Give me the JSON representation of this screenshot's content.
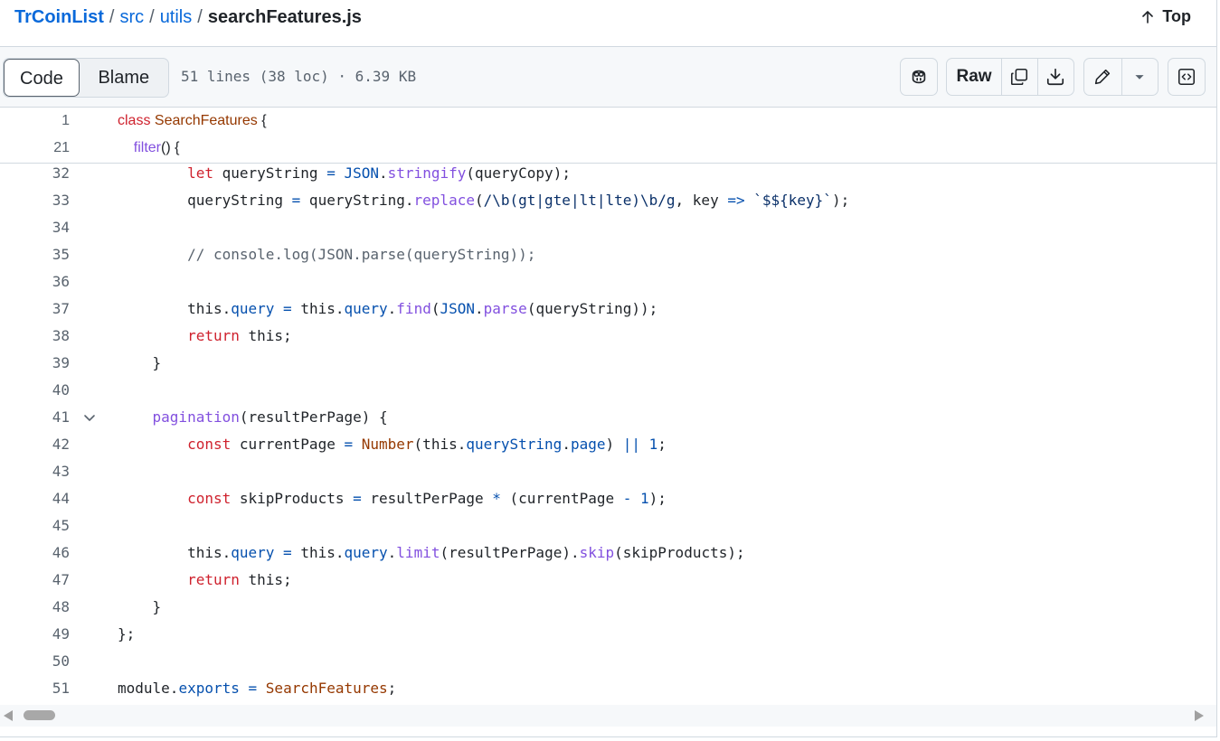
{
  "breadcrumb": {
    "repo": "TrCoinList",
    "dirs": [
      "src",
      "utils"
    ],
    "file": "searchFeatures.js",
    "separator": "/"
  },
  "top_link": "Top",
  "toolbar": {
    "tab_code": "Code",
    "tab_blame": "Blame",
    "file_info": "51 lines (38 loc) · 6.39 KB",
    "raw_label": "Raw"
  },
  "sticky_lines": [
    {
      "n": "1",
      "html": "<span class=\"k\">class</span> <span class=\"ent\">SearchFeatures</span> {"
    },
    {
      "n": "21",
      "html": "    <span class=\"f\">filter</span>() {"
    }
  ],
  "lines": [
    {
      "n": "32",
      "html": "        <span class=\"k\">let</span> queryString <span class=\"c\">=</span> <span class=\"c\">JSON</span>.<span class=\"f\">stringify</span>(queryCopy);"
    },
    {
      "n": "33",
      "html": "        queryString <span class=\"c\">=</span> queryString.<span class=\"f\">replace</span>(<span class=\"s\">/\\b(gt|gte|lt|lte)\\b/g</span>, key <span class=\"c\">=&gt;</span> <span class=\"s\">`$${key}`</span>);"
    },
    {
      "n": "34",
      "html": ""
    },
    {
      "n": "35",
      "html": "        <span class=\"cm\">// console.log(JSON.parse(queryString));</span>"
    },
    {
      "n": "36",
      "html": ""
    },
    {
      "n": "37",
      "html": "        this.<span class=\"c\">query</span> <span class=\"c\">=</span> this.<span class=\"c\">query</span>.<span class=\"f\">find</span>(<span class=\"c\">JSON</span>.<span class=\"f\">parse</span>(queryString));"
    },
    {
      "n": "38",
      "html": "        <span class=\"k\">return</span> this;"
    },
    {
      "n": "39",
      "html": "    }"
    },
    {
      "n": "40",
      "html": ""
    },
    {
      "n": "41",
      "html": "    <span class=\"f\">pagination</span>(resultPerPage) {",
      "fold": true
    },
    {
      "n": "42",
      "html": "        <span class=\"k\">const</span> currentPage <span class=\"c\">=</span> <span class=\"ent\">Number</span>(this.<span class=\"c\">queryString</span>.<span class=\"c\">page</span>) <span class=\"c\">||</span> <span class=\"c\">1</span>;"
    },
    {
      "n": "43",
      "html": ""
    },
    {
      "n": "44",
      "html": "        <span class=\"k\">const</span> skipProducts <span class=\"c\">=</span> resultPerPage <span class=\"c\">*</span> (currentPage <span class=\"c\">-</span> <span class=\"c\">1</span>);"
    },
    {
      "n": "45",
      "html": ""
    },
    {
      "n": "46",
      "html": "        this.<span class=\"c\">query</span> <span class=\"c\">=</span> this.<span class=\"c\">query</span>.<span class=\"f\">limit</span>(resultPerPage).<span class=\"f\">skip</span>(skipProducts);"
    },
    {
      "n": "47",
      "html": "        <span class=\"k\">return</span> this;"
    },
    {
      "n": "48",
      "html": "    }"
    },
    {
      "n": "49",
      "html": "};"
    },
    {
      "n": "50",
      "html": ""
    },
    {
      "n": "51",
      "html": "module.<span class=\"c\">exports</span> <span class=\"c\">=</span> <span class=\"ent\">SearchFeatures</span>;"
    }
  ]
}
